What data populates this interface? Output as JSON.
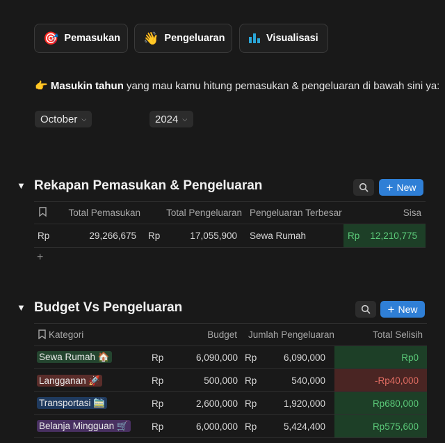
{
  "nav": [
    {
      "icon": "🎯",
      "label": "Pemasukan"
    },
    {
      "icon": "👋",
      "label": "Pengeluaran"
    },
    {
      "icon": "📊",
      "label": "Visualisasi"
    }
  ],
  "prompt": {
    "icon": "👉",
    "bold": "Masukin tahun",
    "rest": " yang mau kamu hitung pemasukan & pengeluaran di bawah sini ya:"
  },
  "filters": {
    "month": "October",
    "year": "2024"
  },
  "colors": {
    "accent": "#2f7fd6",
    "positive": "#5ccb7a",
    "negative": "#e26d62"
  },
  "rekapan": {
    "title": "Rekapan Pemasukan & Pengeluaran",
    "new_label": "New",
    "headers": {
      "total_pemasukan": "Total Pemasukan",
      "total_pengeluaran": "Total Pengeluaran",
      "pengeluaran_terbesar": "Pengeluaran Terbesar",
      "sisa": "Sisa"
    },
    "row": {
      "pemasukan_cur": "Rp",
      "pemasukan": "29,266,675",
      "pengeluaran_cur": "Rp",
      "pengeluaran": "17,055,900",
      "terbesar": "Sewa Rumah",
      "sisa_cur": "Rp",
      "sisa": "12,210,775"
    },
    "add_row": "+"
  },
  "budget": {
    "title": "Budget Vs Pengeluaran",
    "new_label": "New",
    "headers": {
      "kategori": "Kategori",
      "budget": "Budget",
      "jumlah": "Jumlah Pengeluaran",
      "selisih": "Total Selisih"
    },
    "rows": [
      {
        "kategori": "Sewa Rumah 🏠",
        "bcur": "Rp",
        "budget": "6,090,000",
        "jcur": "Rp",
        "jumlah": "6,090,000",
        "selisih": "Rp0"
      },
      {
        "kategori": "Langganan 🚀",
        "bcur": "Rp",
        "budget": "500,000",
        "jcur": "Rp",
        "jumlah": "540,000",
        "selisih": "-Rp40,000"
      },
      {
        "kategori": "Transportasi 🚞",
        "bcur": "Rp",
        "budget": "2,600,000",
        "jcur": "Rp",
        "jumlah": "1,920,000",
        "selisih": "Rp680,000"
      },
      {
        "kategori": "Belanja Mingguan 🛒",
        "bcur": "Rp",
        "budget": "6,000,000",
        "jcur": "Rp",
        "jumlah": "5,424,400",
        "selisih": "Rp575,600"
      }
    ]
  }
}
